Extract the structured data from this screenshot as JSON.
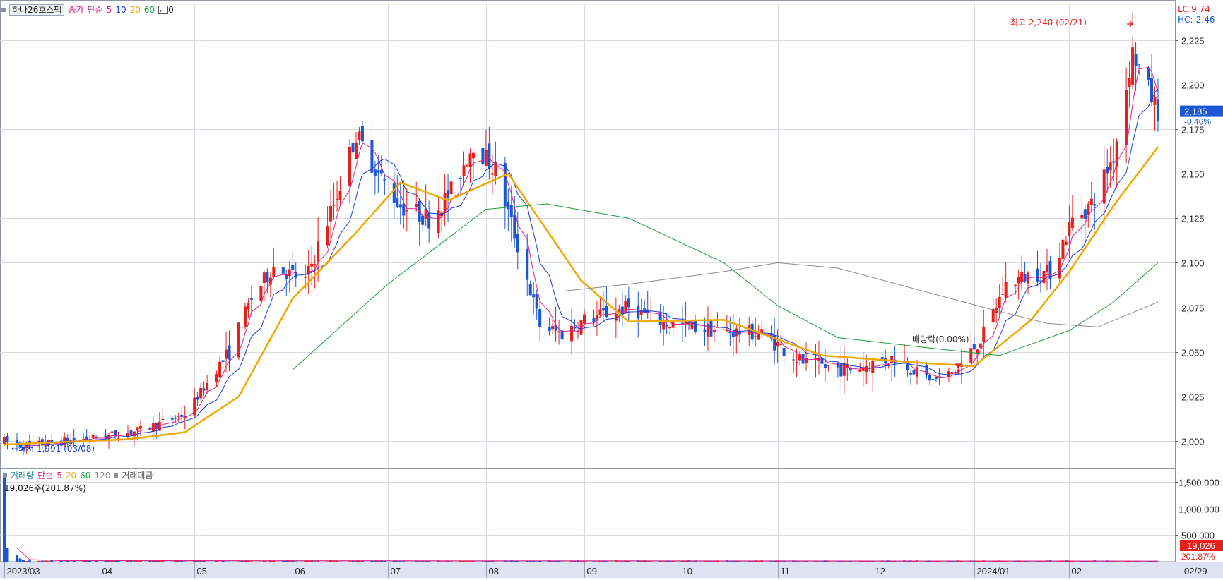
{
  "legend": {
    "symbol": "하나26호스팩",
    "price_label": "종가",
    "ma_type": "단순",
    "ma_periods": [
      "5",
      "10",
      "20",
      "60"
    ],
    "ma_extra": "0",
    "ma_colors": [
      "#e0208a",
      "#1a3bd6",
      "#f0a800",
      "#18a038"
    ]
  },
  "volume_legend": {
    "label": "거래량",
    "ma_type": "단순",
    "periods": [
      "5",
      "20",
      "60",
      "120"
    ],
    "period_colors": [
      "#e0208a",
      "#f0a800",
      "#18a038",
      "#8a8a8a"
    ],
    "amount_label": "거래대금",
    "readout": "19,026주(201.87%)"
  },
  "corner": {
    "lc": "LC:9.74",
    "hc": "HC:-2.46"
  },
  "annotations": {
    "high": "최고 2,240 (02/21)",
    "low": "최저 1,991 (03/08)",
    "dividend": "배당락(0.00%)"
  },
  "current": {
    "price": "2,185",
    "change": "-0.46%",
    "volume": "19,026",
    "volume_pct": "201.87%"
  },
  "chart_data": {
    "type": "candlestick",
    "period_start": "2023-03-02",
    "period_end": "2024-02-29",
    "price_axis": {
      "ticks": [
        "2,000",
        "2,025",
        "2,050",
        "2,075",
        "2,100",
        "2,125",
        "2,150",
        "2,175",
        "2,200",
        "2,225"
      ],
      "range": [
        1985,
        2245
      ]
    },
    "volume_axis": {
      "ticks": [
        "500,000",
        "1,000,000",
        "1,500,000"
      ],
      "range": [
        0,
        1650000
      ]
    },
    "x_labels": [
      "2023/03",
      "04",
      "05",
      "06",
      "07",
      "08",
      "09",
      "10",
      "11",
      "12",
      "2024/01",
      "02",
      "02/29"
    ],
    "colors": {
      "up": "#e8201c",
      "down": "#1a56d6",
      "ma5": "#e0208a",
      "ma10": "#1a3bd6",
      "ma20": "#f0a800",
      "ma60": "#18a038",
      "ma120": "#8a8a8a"
    },
    "close_path": [
      [
        "2023-03-02",
        2000
      ],
      [
        "2023-03-08",
        1997
      ],
      [
        "2023-03-31",
        2002
      ],
      [
        "2023-04-14",
        2006
      ],
      [
        "2023-04-28",
        2015
      ],
      [
        "2023-05-12",
        2050
      ],
      [
        "2023-05-19",
        2080
      ],
      [
        "2023-05-26",
        2098
      ],
      [
        "2023-06-05",
        2090
      ],
      [
        "2023-06-14",
        2133
      ],
      [
        "2023-06-21",
        2172
      ],
      [
        "2023-06-28",
        2150
      ],
      [
        "2023-07-05",
        2132
      ],
      [
        "2023-07-14",
        2125
      ],
      [
        "2023-07-21",
        2140
      ],
      [
        "2023-07-28",
        2167
      ],
      [
        "2023-08-04",
        2152
      ],
      [
        "2023-08-11",
        2110
      ],
      [
        "2023-08-18",
        2065
      ],
      [
        "2023-08-25",
        2060
      ],
      [
        "2023-09-01",
        2068
      ],
      [
        "2023-09-15",
        2075
      ],
      [
        "2023-09-27",
        2066
      ],
      [
        "2023-10-13",
        2062
      ],
      [
        "2023-10-27",
        2060
      ],
      [
        "2023-11-10",
        2043
      ],
      [
        "2023-11-24",
        2040
      ],
      [
        "2023-12-08",
        2047
      ],
      [
        "2023-12-20",
        2034
      ],
      [
        "2023-12-28",
        2040
      ],
      [
        "2024-01-05",
        2060
      ],
      [
        "2024-01-12",
        2088
      ],
      [
        "2024-01-19",
        2093
      ],
      [
        "2024-01-26",
        2095
      ],
      [
        "2024-02-02",
        2124
      ],
      [
        "2024-02-08",
        2133
      ],
      [
        "2024-02-15",
        2160
      ],
      [
        "2024-02-21",
        2218
      ],
      [
        "2024-02-26",
        2197
      ],
      [
        "2024-02-29",
        2185
      ]
    ],
    "ma_paths": {
      "ma20": [
        [
          "2023-03-02",
          1998
        ],
        [
          "2023-04-10",
          2001
        ],
        [
          "2023-04-28",
          2005
        ],
        [
          "2023-05-15",
          2025
        ],
        [
          "2023-06-01",
          2080
        ],
        [
          "2023-06-20",
          2115
        ],
        [
          "2023-07-05",
          2145
        ],
        [
          "2023-07-20",
          2135
        ],
        [
          "2023-08-08",
          2150
        ],
        [
          "2023-08-31",
          2090
        ],
        [
          "2023-09-15",
          2067
        ],
        [
          "2023-10-15",
          2068
        ],
        [
          "2023-11-15",
          2048
        ],
        [
          "2023-12-15",
          2044
        ],
        [
          "2024-01-02",
          2042
        ],
        [
          "2024-01-20",
          2068
        ],
        [
          "2024-02-01",
          2095
        ],
        [
          "2024-02-15",
          2132
        ],
        [
          "2024-02-29",
          2165
        ]
      ],
      "ma60": [
        [
          "2023-06-01",
          2040
        ],
        [
          "2023-07-01",
          2088
        ],
        [
          "2023-08-01",
          2130
        ],
        [
          "2023-08-20",
          2133
        ],
        [
          "2023-09-15",
          2125
        ],
        [
          "2023-10-15",
          2100
        ],
        [
          "2023-11-01",
          2076
        ],
        [
          "2023-11-20",
          2058
        ],
        [
          "2023-12-20",
          2052
        ],
        [
          "2024-01-10",
          2048
        ],
        [
          "2024-02-01",
          2062
        ],
        [
          "2024-02-15",
          2078
        ],
        [
          "2024-02-29",
          2100
        ]
      ],
      "ma120": [
        [
          "2023-08-25",
          2084
        ],
        [
          "2023-09-15",
          2088
        ],
        [
          "2023-10-15",
          2095
        ],
        [
          "2023-11-01",
          2100
        ],
        [
          "2023-11-20",
          2097
        ],
        [
          "2023-12-15",
          2085
        ],
        [
          "2024-01-05",
          2075
        ],
        [
          "2024-01-25",
          2066
        ],
        [
          "2024-02-10",
          2064
        ],
        [
          "2024-02-29",
          2078
        ]
      ]
    },
    "highlights": [
      {
        "label": "최고",
        "date": "2024-02-21",
        "value": 2240
      },
      {
        "label": "최저",
        "date": "2023-03-08",
        "value": 1991
      },
      {
        "label": "배당락",
        "date": "2023-12-28",
        "value": 2045
      }
    ],
    "volume_spikes": [
      [
        "2023-03-02",
        1600000
      ],
      [
        "2023-03-03",
        260000
      ],
      [
        "2023-03-06",
        130000
      ],
      [
        "2023-03-07",
        60000
      ],
      [
        "2023-03-08",
        40000
      ]
    ]
  }
}
